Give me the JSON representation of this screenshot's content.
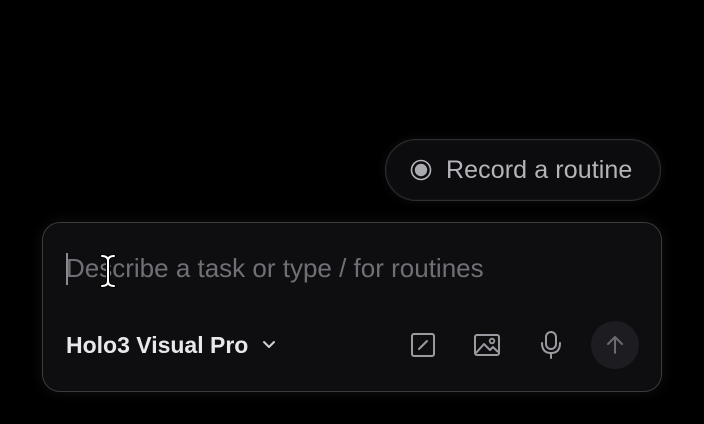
{
  "record": {
    "label": "Record a routine",
    "icon": "record-icon"
  },
  "composer": {
    "placeholder": "Describe a task or type / for routines",
    "value": "",
    "model_label": "Holo3 Visual Pro",
    "tools": [
      {
        "name": "edit-icon",
        "label": "Edit"
      },
      {
        "name": "image-icon",
        "label": "Image"
      },
      {
        "name": "microphone-icon",
        "label": "Voice"
      }
    ],
    "send_icon": "arrow-up-icon"
  },
  "colors": {
    "background": "#000000",
    "card": "#0e0e10",
    "border": "#3a3a3f",
    "text_primary": "#e8e8ec",
    "text_muted": "#6f6f76",
    "icon": "#9a9aa1"
  }
}
